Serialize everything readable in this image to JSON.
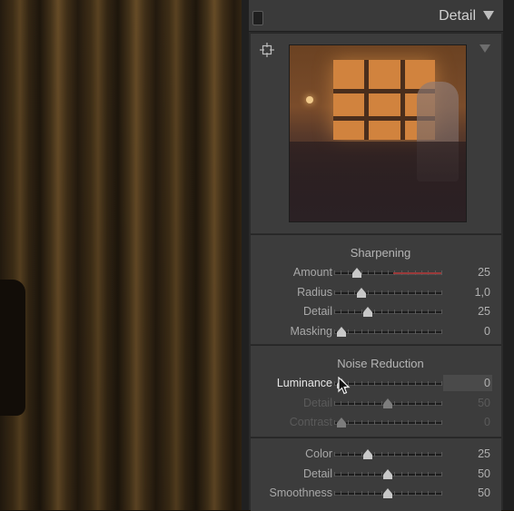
{
  "panel": {
    "title": "Detail"
  },
  "sharpening": {
    "title": "Sharpening",
    "rows": [
      {
        "label": "Amount",
        "value": "25",
        "fraction": 0.17
      },
      {
        "label": "Radius",
        "value": "1,0",
        "fraction": 0.22
      },
      {
        "label": "Detail",
        "value": "25",
        "fraction": 0.28
      },
      {
        "label": "Masking",
        "value": "0",
        "fraction": 0.0
      }
    ]
  },
  "noise_reduction": {
    "title": "Noise Reduction",
    "rows": [
      {
        "label": "Luminance",
        "value": "0",
        "fraction": 0.0
      },
      {
        "label": "Detail",
        "value": "50",
        "fraction": 0.5
      },
      {
        "label": "Contrast",
        "value": "0",
        "fraction": 0.0
      }
    ]
  },
  "color": {
    "rows": [
      {
        "label": "Color",
        "value": "25",
        "fraction": 0.28
      },
      {
        "label": "Detail",
        "value": "50",
        "fraction": 0.5
      },
      {
        "label": "Smoothness",
        "value": "50",
        "fraction": 0.5
      }
    ]
  },
  "colors": {
    "panel_bg": "#3c3c3c",
    "amount_track_accent": "#9a3a3a"
  }
}
